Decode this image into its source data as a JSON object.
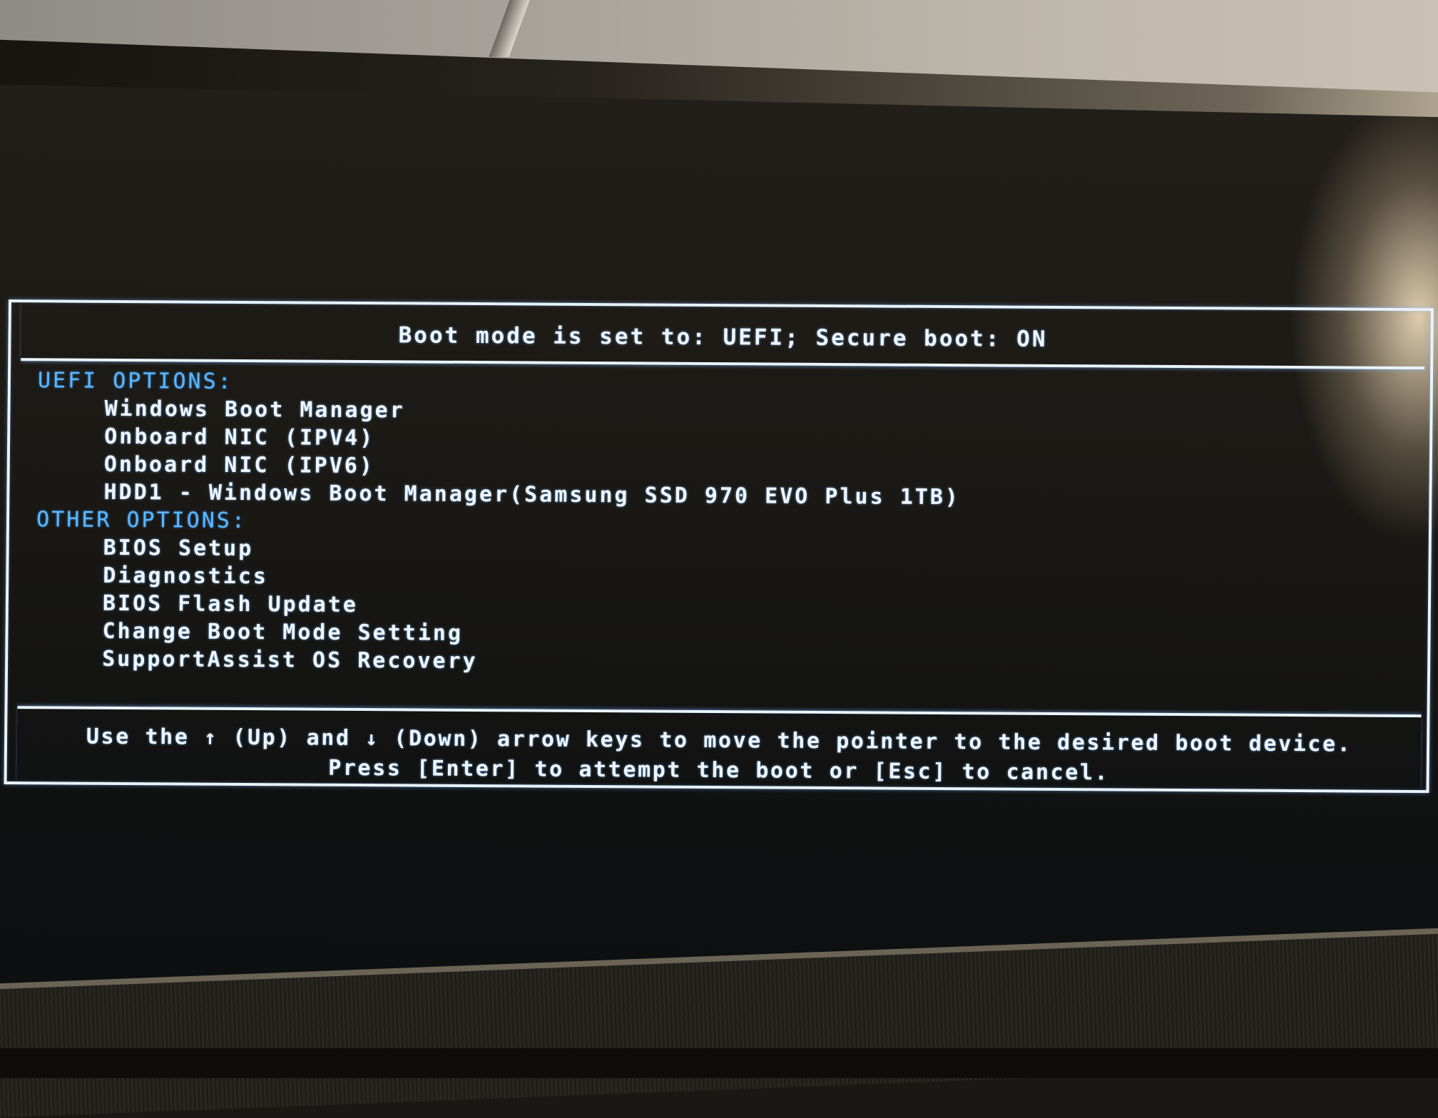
{
  "header": {
    "boot_mode_text": "Boot mode is set to: UEFI; Secure boot: ON"
  },
  "sections": {
    "uefi": {
      "label": "UEFI OPTIONS:",
      "items": [
        "Windows Boot Manager",
        "Onboard NIC (IPV4)",
        "Onboard NIC (IPV6)",
        "HDD1 - Windows Boot Manager(Samsung SSD 970 EVO Plus 1TB)"
      ]
    },
    "other": {
      "label": "OTHER OPTIONS:",
      "items": [
        "BIOS Setup",
        "Diagnostics",
        "BIOS Flash Update",
        "Change Boot Mode Setting",
        "SupportAssist OS Recovery"
      ]
    }
  },
  "footer": {
    "line1_prefix": "Use the",
    "up_arrow": "↑",
    "up_label": "(Up) and",
    "down_arrow": "↓",
    "line1_suffix": "(Down) arrow keys to move the pointer to the desired boot device.",
    "line2": "Press [Enter] to attempt the boot or [Esc] to cancel."
  },
  "colors": {
    "text": "#eef6ff",
    "section_label": "#5ab8ff",
    "border": "#e8f4ff",
    "background": "#121212"
  }
}
